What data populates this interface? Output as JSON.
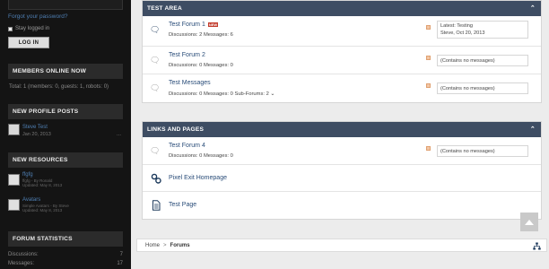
{
  "sidebar": {
    "forgot_password": "Forgot your password?",
    "stay_logged_in": "Stay logged in",
    "login_button": "LOG IN",
    "members_online": {
      "title": "MEMBERS ONLINE NOW",
      "total": "Total: 1 (members: 0, guests: 1, robots: 0)"
    },
    "new_profile_posts": {
      "title": "NEW PROFILE POSTS",
      "post": {
        "name": "Steve Test",
        "date": "Jan 20, 2013",
        "more": "..."
      }
    },
    "new_resources": {
      "title": "NEW RESOURCES",
      "items": [
        {
          "title": "ffgfg",
          "by": "ffgfg - By Ronald",
          "updated": "Updated: May 8, 2013"
        },
        {
          "title": "Avatars",
          "by": "Simple Avatars - By Steve",
          "updated": "Updated: May 8, 2013"
        }
      ]
    },
    "forum_statistics": {
      "title": "FORUM STATISTICS",
      "discussions_label": "Discussions:",
      "discussions_value": "7",
      "messages_label": "Messages:",
      "messages_value": "17"
    }
  },
  "test_area": {
    "title": "TEST AREA",
    "forums": [
      {
        "title": "Test Forum 1",
        "badge": "NEW",
        "stats": "Discussions: 2   Messages: 6",
        "latest_line1": "Latest: Testing",
        "latest_line2": "Steve, Oct 20, 2013"
      },
      {
        "title": "Test Forum 2",
        "stats": "Discussions: 0   Messages: 0",
        "latest": "(Contains no messages)"
      },
      {
        "title": "Test Messages",
        "stats": "Discussions: 0   Messages: 0   Sub-Forums: 2",
        "latest": "(Contains no messages)"
      }
    ]
  },
  "links_and_pages": {
    "title": "LINKS AND PAGES",
    "forum": {
      "title": "Test Forum 4",
      "stats": "Discussions: 0   Messages: 0",
      "latest": "(Contains no messages)"
    },
    "link_title": "Pixel Exit Homepage",
    "page_title": "Test Page"
  },
  "breadcrumb": {
    "home": "Home",
    "separator": ">",
    "current": "Forums"
  },
  "colors": {
    "sidebar_bg": "#141414",
    "panel_header": "#3e4d63",
    "link": "#2a4d79",
    "new_badge": "#c23a2b"
  }
}
